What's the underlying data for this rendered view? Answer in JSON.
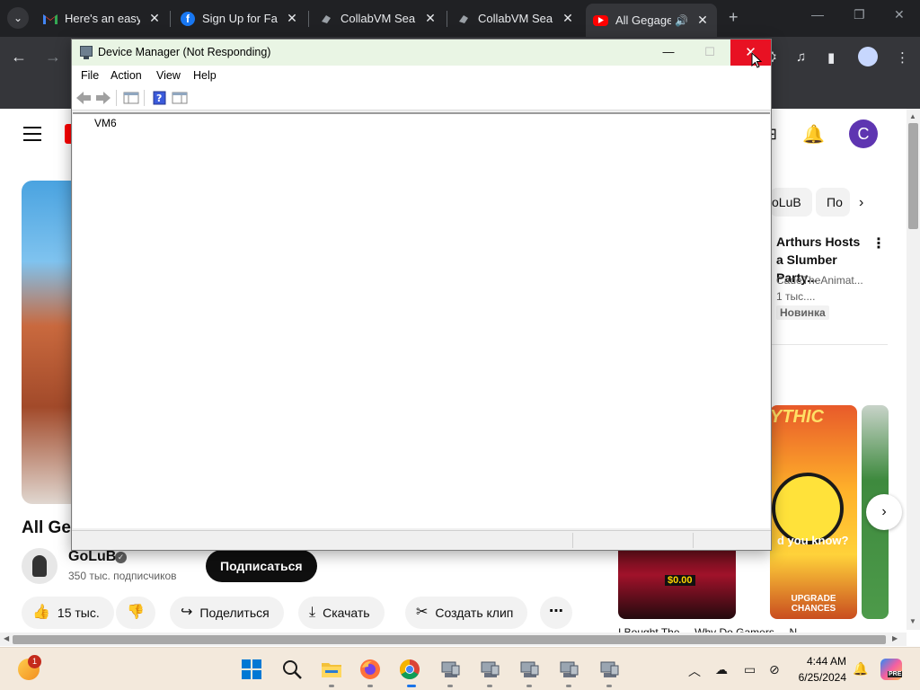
{
  "browser": {
    "tabs": [
      {
        "title": "Here's an easy",
        "favicon": "gmail-icon"
      },
      {
        "title": "Sign Up for Fa",
        "favicon": "facebook-icon"
      },
      {
        "title": "CollabVM Sear",
        "favicon": "collabvm-icon"
      },
      {
        "title": "CollabVM Sear",
        "favicon": "collabvm-icon"
      },
      {
        "title": "All Gegage",
        "favicon": "youtube-icon",
        "active": true,
        "audio": true
      }
    ],
    "new_tab_glyph": "+",
    "colors": {
      "chrome_bg": "#202124",
      "toolbar_bg": "#35363a"
    }
  },
  "youtube": {
    "video_title": "All Ge",
    "channel": {
      "name": "GoLuB",
      "subscribers": "350 тыс. подписчиков"
    },
    "subscribe_label": "Подписаться",
    "actions": {
      "like_count": "15 тыс.",
      "share_label": "Поделиться",
      "download_label": "Скачать",
      "clip_label": "Создать клип"
    },
    "avatar_letter": "C",
    "chips": [
      "oLuB",
      "По"
    ],
    "recommendation": {
      "title": "Arthurs Hosts a Slumber Party...",
      "channel": "CadeTheAnimat...",
      "views": "1 тыс....",
      "badge": "Новинка"
    },
    "shorts": {
      "mythic_text": "YTHIC",
      "caption": "d you know?",
      "upgrade_text": "UPGRADE CHANCES",
      "slot_amount": "$0.00"
    },
    "bottom_strip": "I Bought The ...    Why Do Gamers ...   N"
  },
  "device_manager": {
    "title": "Device Manager (Not Responding)",
    "menu": [
      "File",
      "Action",
      "View",
      "Help"
    ],
    "tree_root": "VM6",
    "colors": {
      "close_red": "#e81123",
      "titlebar_bg": "#e9f5e4"
    }
  },
  "taskbar": {
    "widget_badge": "1",
    "time": "4:44 AM",
    "date": "6/25/2024",
    "copilot_label": "PRE"
  }
}
